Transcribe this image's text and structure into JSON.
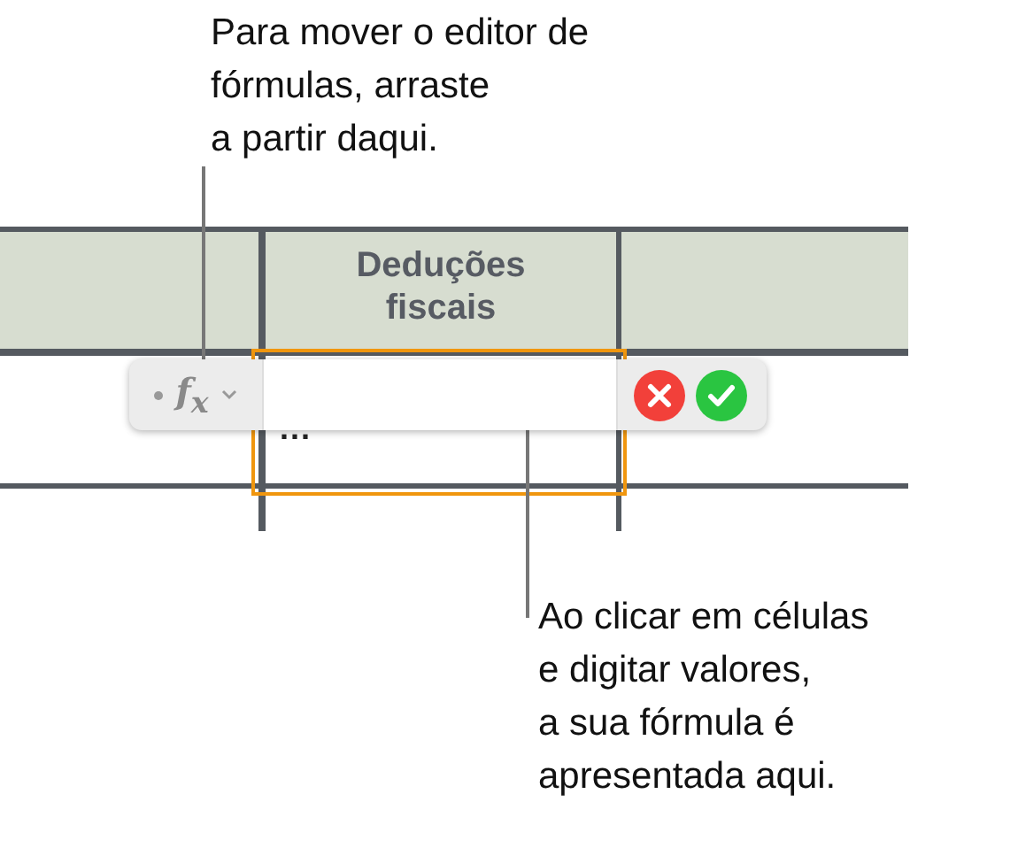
{
  "callouts": [
    {
      "text": "Para mover o editor de\nfórmulas, arraste\na partir daqui."
    },
    {
      "text": "Ao clicar em células\ne digitar valores,\na sua fórmula é\napresentada aqui."
    }
  ],
  "table": {
    "header": "Deduções\nfiscais",
    "cell": {
      "value": "...",
      "selected": true
    }
  },
  "formula_editor": {
    "function_label": "f$_{x}$"
  }
}
